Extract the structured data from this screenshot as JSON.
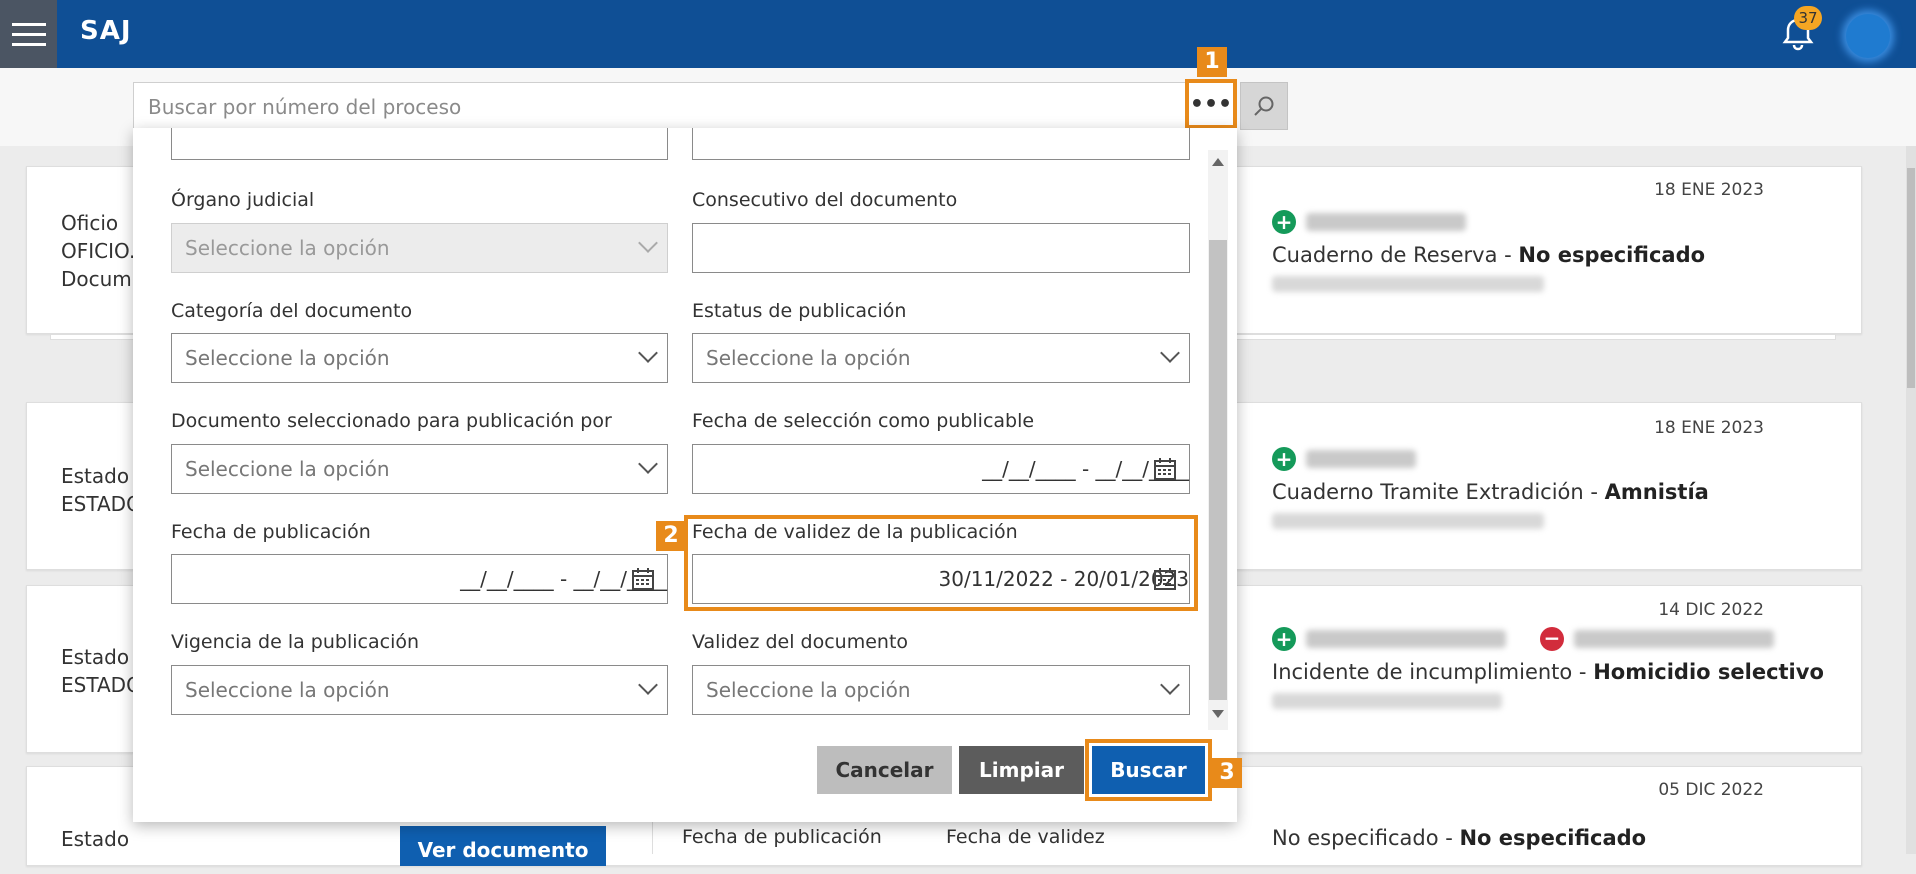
{
  "app": {
    "title": "SAJ",
    "notification_count": "37"
  },
  "search": {
    "placeholder": "Buscar por número del proceso"
  },
  "callouts": [
    "1",
    "2",
    "3"
  ],
  "filters": {
    "organo_judicial": {
      "label": "Órgano judicial",
      "value": "Seleccione la opción"
    },
    "consecutivo": {
      "label": "Consecutivo del documento",
      "value": ""
    },
    "categoria": {
      "label": "Categoría del documento",
      "value": "Seleccione la opción"
    },
    "estatus": {
      "label": "Estatus de publicación",
      "value": "Seleccione la opción"
    },
    "seleccionado_por": {
      "label": "Documento seleccionado para publicación por",
      "value": "Seleccione la opción"
    },
    "fecha_seleccion": {
      "label": "Fecha de selección como publicable",
      "value": "__/__/____ - __/__/____"
    },
    "fecha_publicacion": {
      "label": "Fecha de publicación",
      "value": "__/__/____ - __/__/____"
    },
    "fecha_validez": {
      "label": "Fecha de validez de la publicación",
      "value": "30/11/2022 - 20/01/2023"
    },
    "vigencia": {
      "label": "Vigencia de la publicación",
      "value": "Seleccione la opción"
    },
    "validez_documento": {
      "label": "Validez del documento",
      "value": "Seleccione la opción"
    }
  },
  "buttons": {
    "cancel": "Cancelar",
    "clear": "Limpiar",
    "search": "Buscar"
  },
  "cards": [
    {
      "left_lines": [
        "Oficio",
        "OFICIO.",
        "Docum"
      ],
      "date": "18 ENE 2023",
      "title": "Cuaderno de Reserva - ",
      "title_bold": "No especificado"
    },
    {
      "left_lines": [
        "Estado",
        "ESTADO"
      ],
      "date": "18 ENE 2023",
      "title": "Cuaderno Tramite Extradición - ",
      "title_bold": "Amnistía"
    },
    {
      "left_lines": [
        "Estado",
        "ESTADO"
      ],
      "date": "14 DIC 2022",
      "title": "Incidente de incumplimiento - ",
      "title_bold": "Homicidio selectivo"
    },
    {
      "left_lines": [
        "Estado"
      ],
      "date": "05 DIC 2022",
      "title": "No especificado - ",
      "title_bold": "No especificado",
      "view_button": "Ver documento",
      "col_pub": "Fecha de publicación",
      "col_val": "Fecha de validez"
    }
  ],
  "colors": {
    "topbar": "#0f4f95",
    "accent": "#e88a1a",
    "primary_button": "#0f5fb0"
  }
}
